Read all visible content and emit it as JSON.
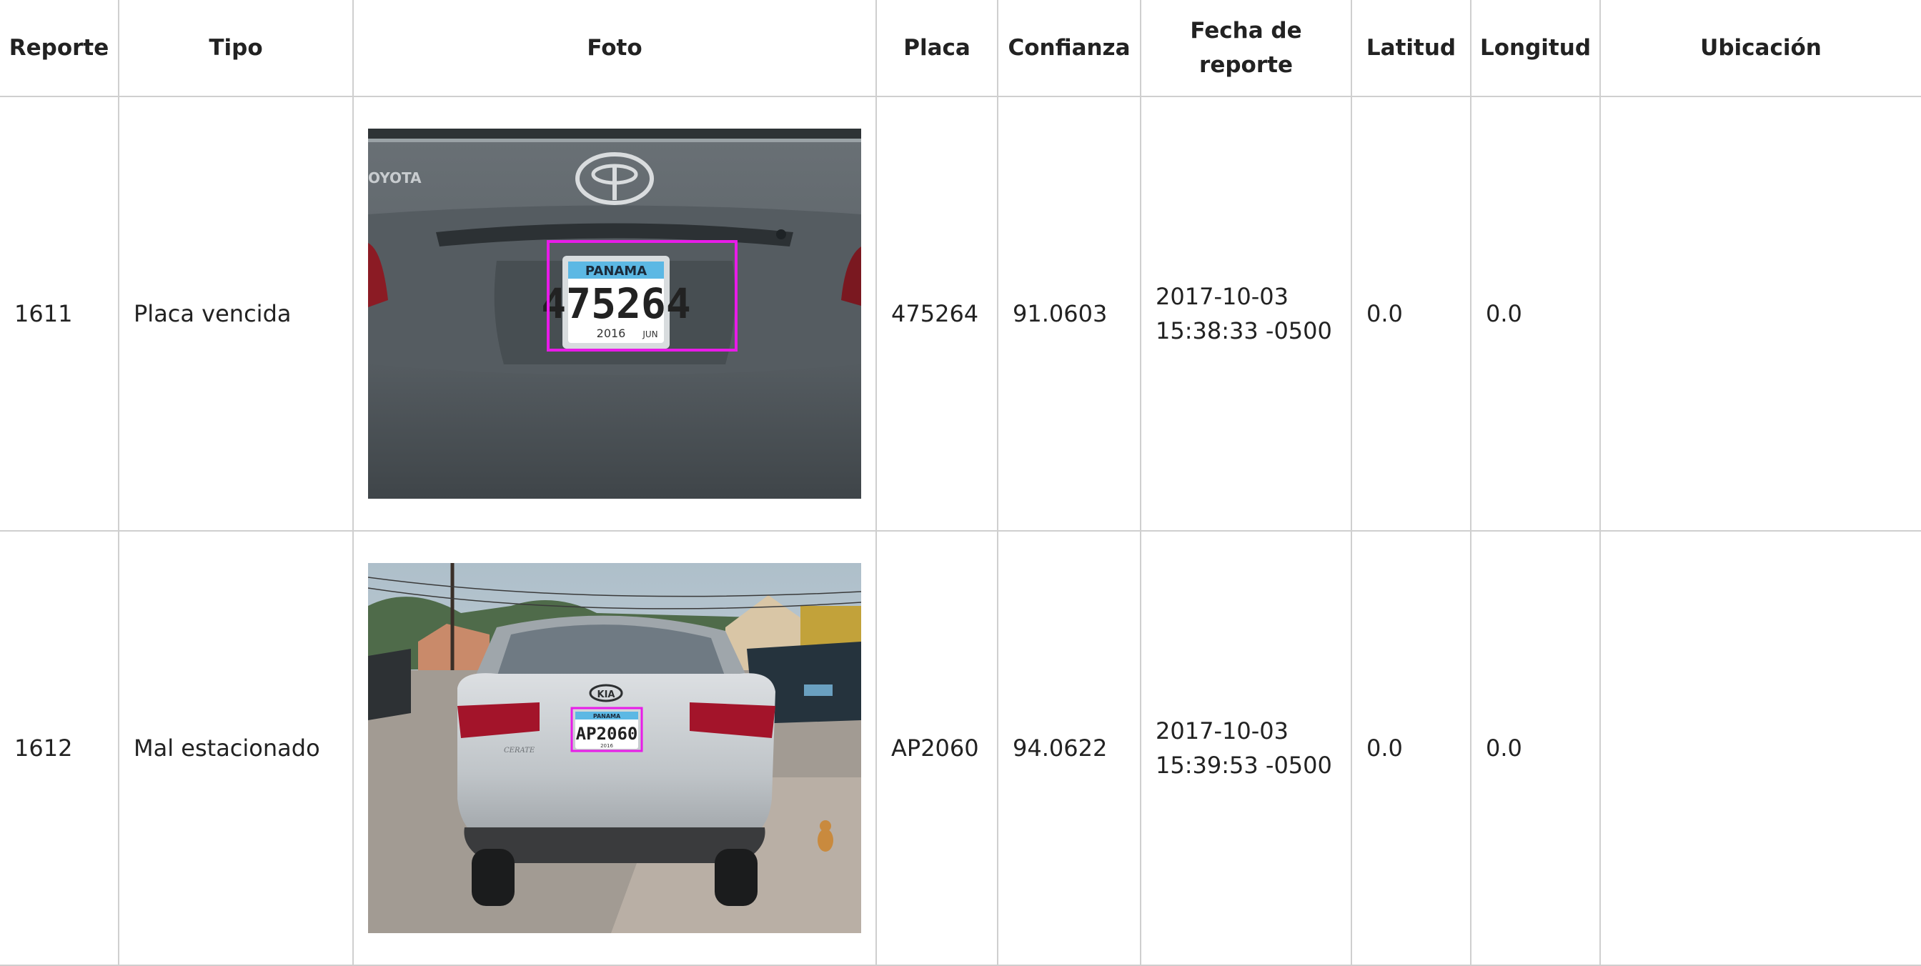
{
  "table": {
    "headers": {
      "reporte": "Reporte",
      "tipo": "Tipo",
      "foto": "Foto",
      "placa": "Placa",
      "confianza": "Confianza",
      "fecha": "Fecha de reporte",
      "latitud": "Latitud",
      "longitud": "Longitud",
      "ubicacion": "Ubicación"
    },
    "rows": [
      {
        "reporte": "1611",
        "tipo": "Placa vencida",
        "placa": "475264",
        "confianza": "91.0603",
        "fecha_line1": "2017-10-03",
        "fecha_line2": "15:38:33 -0500",
        "latitud": "0.0",
        "longitud": "0.0",
        "ubicacion": "",
        "photo": {
          "make_badge": "OYOTA",
          "plate_country": "PANAMA",
          "plate_number": "475264",
          "plate_year": "2016",
          "plate_month": "JUN"
        }
      },
      {
        "reporte": "1612",
        "tipo": "Mal estacionado",
        "placa": "AP2060",
        "confianza": "94.0622",
        "fecha_line1": "2017-10-03",
        "fecha_line2": "15:39:53 -0500",
        "latitud": "0.0",
        "longitud": "0.0",
        "ubicacion": "",
        "photo": {
          "make_badge": "KIA",
          "model_badge": "CERATE",
          "plate_country": "PANAMA",
          "plate_number": "AP2060",
          "plate_year": "2016"
        }
      }
    ]
  },
  "colors": {
    "border": "#cfcfcf",
    "detection_box": "#e81be8",
    "plate_blue": "#5cb8e4"
  }
}
